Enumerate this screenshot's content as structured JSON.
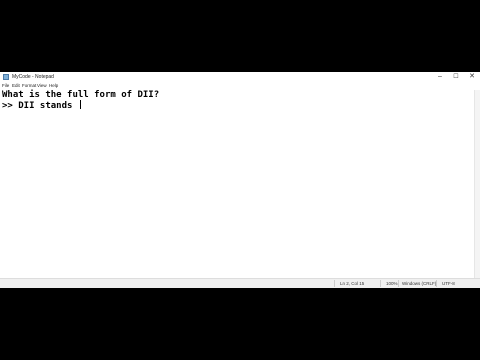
{
  "window": {
    "title": "MyCode - Notepad",
    "controls": {
      "minimize": "–",
      "maximize": "☐",
      "close": "✕"
    }
  },
  "menu": [
    "File",
    "Edit",
    "Format",
    "View",
    "Help"
  ],
  "editor": {
    "lines": [
      "What is the full form of DII?",
      ">> DII stands "
    ]
  },
  "status": {
    "position": "Ln 2, Col 15",
    "zoom": "100%",
    "line_ending": "Windows (CRLF)",
    "encoding": "UTF-8"
  }
}
